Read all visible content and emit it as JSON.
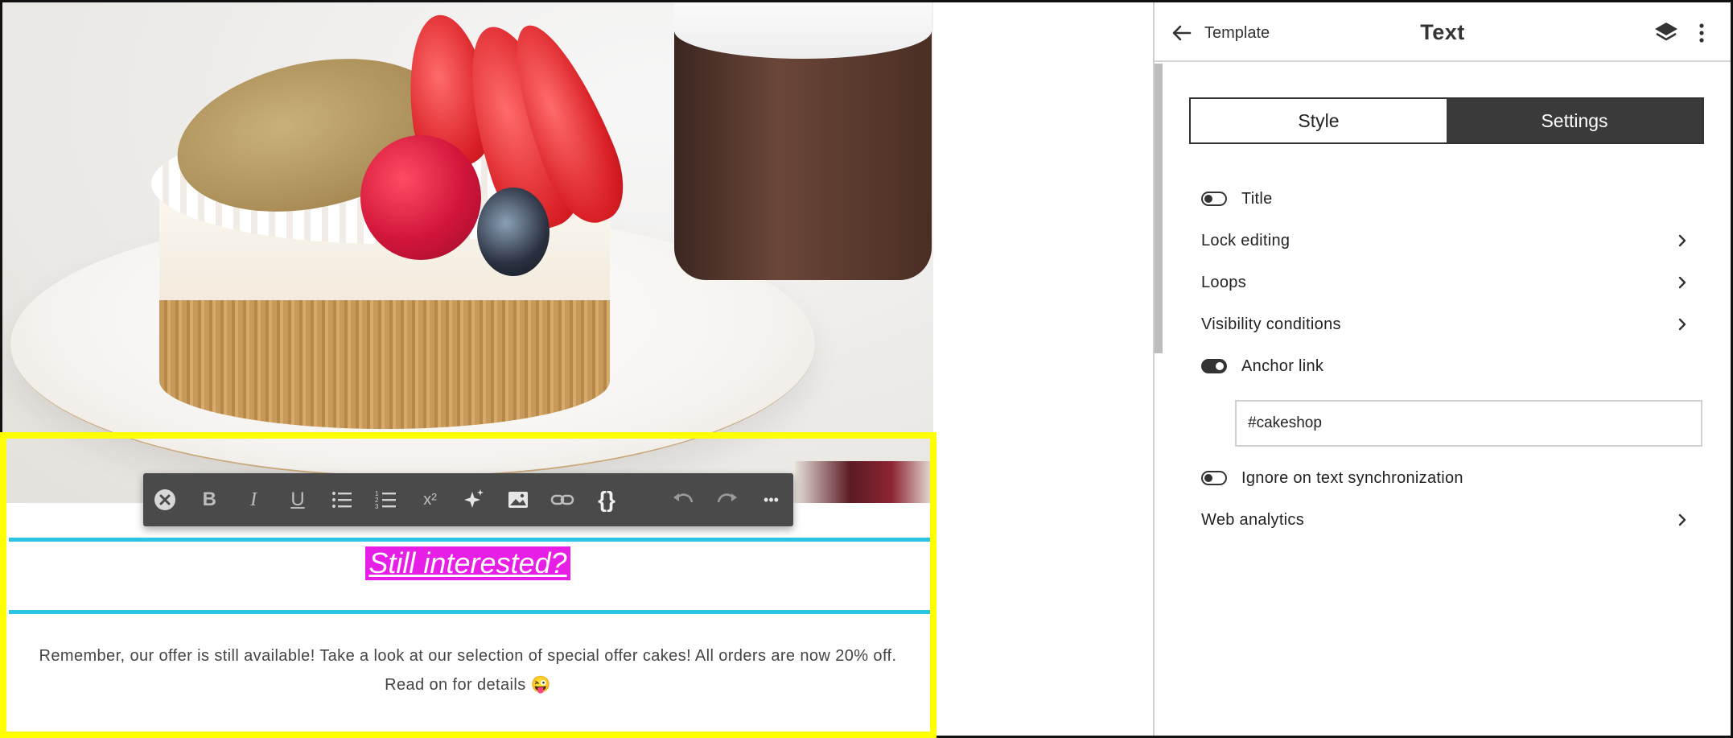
{
  "canvas": {
    "headline": "Still interested?",
    "body": "Remember, our offer is still available! Take a look at our selection of special offer cakes! All orders are now 20% off. Read on for details 😜",
    "hero_image_alt": "Cake with strawberries, raspberry and blueberry on a plate"
  },
  "toolbar": {
    "buttons": [
      {
        "name": "close-icon",
        "glyph": "✕"
      },
      {
        "name": "bold-icon",
        "glyph": "B"
      },
      {
        "name": "italic-icon",
        "glyph": "I"
      },
      {
        "name": "underline-icon",
        "glyph": "U"
      },
      {
        "name": "bulleted-list-icon",
        "glyph": ""
      },
      {
        "name": "numbered-list-icon",
        "glyph": ""
      },
      {
        "name": "superscript-icon",
        "glyph": "x²"
      },
      {
        "name": "ai-sparkle-icon",
        "glyph": ""
      },
      {
        "name": "image-icon",
        "glyph": ""
      },
      {
        "name": "link-icon",
        "glyph": ""
      },
      {
        "name": "merge-tag-icon",
        "glyph": "{}"
      },
      {
        "name": "undo-icon",
        "glyph": ""
      },
      {
        "name": "redo-icon",
        "glyph": ""
      },
      {
        "name": "more-options-icon",
        "glyph": "•••"
      }
    ]
  },
  "panel": {
    "back_label": "Template",
    "title": "Text",
    "tabs": [
      {
        "label": "Style",
        "active": false
      },
      {
        "label": "Settings",
        "active": true
      }
    ],
    "settings": {
      "title_label": "Title",
      "title_enabled": false,
      "lock_editing": "Lock editing",
      "loops": "Loops",
      "visibility_conditions": "Visibility conditions",
      "anchor_link_label": "Anchor link",
      "anchor_link_enabled": true,
      "anchor_link_value": "#cakeshop",
      "ignore_sync_label": "Ignore on text synchronization",
      "ignore_sync_enabled": false,
      "web_analytics": "Web analytics"
    }
  },
  "colors": {
    "highlight": "#ffff00",
    "headline_bg": "#e61ee6",
    "divider_line": "#2bc4e4",
    "toolbar_bg": "#4a4a4a",
    "active_tab_bg": "#3a3a3a"
  }
}
